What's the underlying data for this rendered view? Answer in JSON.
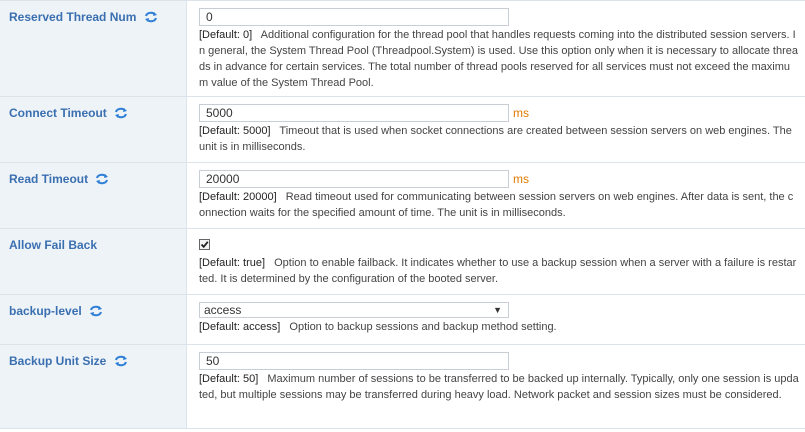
{
  "rows": [
    {
      "label": "Reserved Thread Num",
      "value": "0",
      "unit": "",
      "default": "[Default: 0]",
      "description": "Additional configuration for the thread pool that handles requests coming into the distributed session servers. In general, the System Thread Pool (Threadpool.System) is used. Use this option only when it is necessary to allocate threads in advance for certain services. The total number of thread pools reserved for all services must not exceed the maximum value of the System Thread Pool."
    },
    {
      "label": "Connect Timeout",
      "value": "5000",
      "unit": "ms",
      "default": "[Default: 5000]",
      "description": "Timeout that is used when socket connections are created between session servers on web engines. The unit is in milliseconds."
    },
    {
      "label": "Read Timeout",
      "value": "20000",
      "unit": "ms",
      "default": "[Default: 20000]",
      "description": "Read timeout used for communicating between session servers on web engines. After data is sent, the connection waits for the specified amount of time. The unit is in milliseconds."
    },
    {
      "label": "Allow Fail Back",
      "checked": true,
      "default": "[Default: true]",
      "description": "Option to enable failback. It indicates whether to use a backup session when a server with a failure is restarted. It is determined by the configuration of the booted server."
    },
    {
      "label": "backup-level",
      "selected": "access",
      "default": "[Default: access]",
      "description": "Option to backup sessions and backup method setting."
    },
    {
      "label": "Backup Unit Size",
      "value": "50",
      "unit": "",
      "default": "[Default: 50]",
      "description": "Maximum number of sessions to be transferred to be backed up internally. Typically, only one session is updated, but multiple sessions may be transferred during heavy load. Network packet and session sizes must be considered."
    }
  ],
  "icons": {
    "refresh": "refresh-icon",
    "check": "check-icon",
    "dropdown": "chevron-down-icon"
  },
  "colors": {
    "label": "#3a6fb0",
    "unit": "#e07a00",
    "label_bg": "#eef3f8"
  }
}
